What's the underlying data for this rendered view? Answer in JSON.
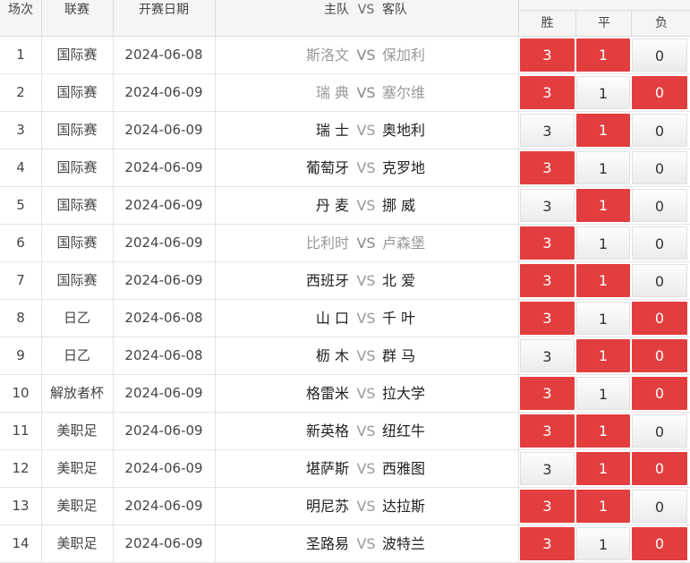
{
  "header": {
    "no": "场次",
    "league": "联赛",
    "time": "开赛日期",
    "home": "主队",
    "vs": "VS",
    "away": "客队",
    "odds_win": "胜",
    "odds_draw": "平",
    "odds_lose": "负"
  },
  "colors": {
    "accent": "#e33e3f"
  },
  "rows": [
    {
      "no": "1",
      "league": "国际赛",
      "date": "2024-06-08",
      "home": "斯洛文",
      "away": "保加利",
      "dim": true,
      "odds": [
        "3",
        "1",
        "0"
      ],
      "sel": [
        true,
        true,
        false
      ]
    },
    {
      "no": "2",
      "league": "国际赛",
      "date": "2024-06-09",
      "home": "瑞 典",
      "away": "塞尔维",
      "dim": true,
      "odds": [
        "3",
        "1",
        "0"
      ],
      "sel": [
        true,
        false,
        true
      ]
    },
    {
      "no": "3",
      "league": "国际赛",
      "date": "2024-06-09",
      "home": "瑞 士",
      "away": "奥地利",
      "dim": false,
      "odds": [
        "3",
        "1",
        "0"
      ],
      "sel": [
        false,
        true,
        false
      ]
    },
    {
      "no": "4",
      "league": "国际赛",
      "date": "2024-06-09",
      "home": "葡萄牙",
      "away": "克罗地",
      "dim": false,
      "odds": [
        "3",
        "1",
        "0"
      ],
      "sel": [
        true,
        false,
        false
      ]
    },
    {
      "no": "5",
      "league": "国际赛",
      "date": "2024-06-09",
      "home": "丹 麦",
      "away": "挪 威",
      "dim": false,
      "odds": [
        "3",
        "1",
        "0"
      ],
      "sel": [
        false,
        true,
        false
      ]
    },
    {
      "no": "6",
      "league": "国际赛",
      "date": "2024-06-09",
      "home": "比利时",
      "away": "卢森堡",
      "dim": true,
      "odds": [
        "3",
        "1",
        "0"
      ],
      "sel": [
        true,
        false,
        false
      ]
    },
    {
      "no": "7",
      "league": "国际赛",
      "date": "2024-06-09",
      "home": "西班牙",
      "away": "北 爱",
      "dim": false,
      "odds": [
        "3",
        "1",
        "0"
      ],
      "sel": [
        true,
        true,
        false
      ]
    },
    {
      "no": "8",
      "league": "日乙",
      "date": "2024-06-08",
      "home": "山 口",
      "away": "千 叶",
      "dim": false,
      "odds": [
        "3",
        "1",
        "0"
      ],
      "sel": [
        true,
        false,
        true
      ]
    },
    {
      "no": "9",
      "league": "日乙",
      "date": "2024-06-08",
      "home": "枥 木",
      "away": "群 马",
      "dim": false,
      "odds": [
        "3",
        "1",
        "0"
      ],
      "sel": [
        false,
        true,
        true
      ]
    },
    {
      "no": "10",
      "league": "解放者杯",
      "date": "2024-06-09",
      "home": "格雷米",
      "away": "拉大学",
      "dim": false,
      "odds": [
        "3",
        "1",
        "0"
      ],
      "sel": [
        true,
        false,
        true
      ]
    },
    {
      "no": "11",
      "league": "美职足",
      "date": "2024-06-09",
      "home": "新英格",
      "away": "纽红牛",
      "dim": false,
      "odds": [
        "3",
        "1",
        "0"
      ],
      "sel": [
        true,
        true,
        false
      ]
    },
    {
      "no": "12",
      "league": "美职足",
      "date": "2024-06-09",
      "home": "堪萨斯",
      "away": "西雅图",
      "dim": false,
      "odds": [
        "3",
        "1",
        "0"
      ],
      "sel": [
        false,
        true,
        true
      ]
    },
    {
      "no": "13",
      "league": "美职足",
      "date": "2024-06-09",
      "home": "明尼苏",
      "away": "达拉斯",
      "dim": false,
      "odds": [
        "3",
        "1",
        "0"
      ],
      "sel": [
        true,
        true,
        false
      ]
    },
    {
      "no": "14",
      "league": "美职足",
      "date": "2024-06-09",
      "home": "圣路易",
      "away": "波特兰",
      "dim": false,
      "odds": [
        "3",
        "1",
        "0"
      ],
      "sel": [
        true,
        false,
        true
      ]
    }
  ]
}
